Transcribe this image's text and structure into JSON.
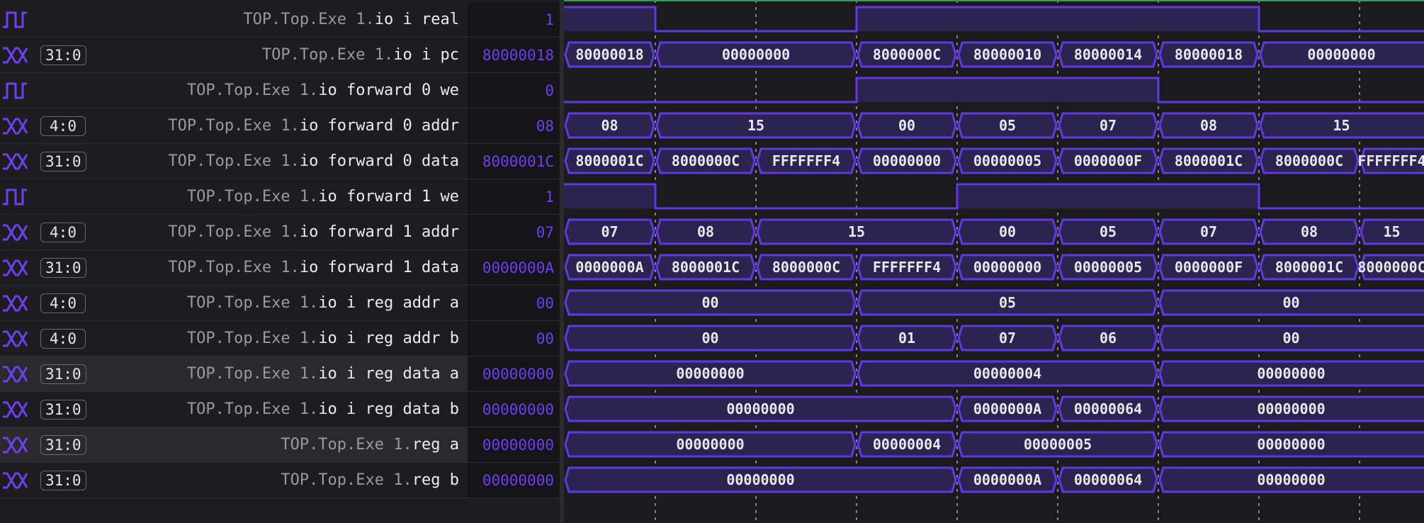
{
  "colors": {
    "accent": "#6d3ff0",
    "wave_stroke": "#6238e6",
    "wave_fill": "#2c2450",
    "background": "#1d1d1f"
  },
  "signals": [
    {
      "type": "bit",
      "width": "",
      "path": "TOP.Top.Exe 1.",
      "tail": "io i real",
      "value": "1"
    },
    {
      "type": "bus",
      "width": "31:0",
      "path": "TOP.Top.Exe 1.",
      "tail": "io i pc",
      "value": "80000018"
    },
    {
      "type": "bit",
      "width": "",
      "path": "TOP.Top.Exe 1.",
      "tail": "io forward 0 we",
      "value": "0"
    },
    {
      "type": "bus",
      "width": "4:0",
      "path": "TOP.Top.Exe 1.",
      "tail": "io forward 0 addr",
      "value": "08"
    },
    {
      "type": "bus",
      "width": "31:0",
      "path": "TOP.Top.Exe 1.",
      "tail": "io forward 0 data",
      "value": "8000001C"
    },
    {
      "type": "bit",
      "width": "",
      "path": "TOP.Top.Exe 1.",
      "tail": "io forward 1 we",
      "value": "1"
    },
    {
      "type": "bus",
      "width": "4:0",
      "path": "TOP.Top.Exe 1.",
      "tail": "io forward 1 addr",
      "value": "07"
    },
    {
      "type": "bus",
      "width": "31:0",
      "path": "TOP.Top.Exe 1.",
      "tail": "io forward 1 data",
      "value": "0000000A"
    },
    {
      "type": "bus",
      "width": "4:0",
      "path": "TOP.Top.Exe 1.",
      "tail": "io i reg addr a",
      "value": "00"
    },
    {
      "type": "bus",
      "width": "4:0",
      "path": "TOP.Top.Exe 1.",
      "tail": "io i reg addr b",
      "value": "00"
    },
    {
      "type": "bus",
      "width": "31:0",
      "path": "TOP.Top.Exe 1.",
      "tail": "io i reg data a",
      "value": "00000000",
      "selected": true
    },
    {
      "type": "bus",
      "width": "31:0",
      "path": "TOP.Top.Exe 1.",
      "tail": "io i reg data b",
      "value": "00000000"
    },
    {
      "type": "bus",
      "width": "31:0",
      "path": "TOP.Top.Exe 1.",
      "tail": "reg a",
      "value": "00000000",
      "selected": true
    },
    {
      "type": "bus",
      "width": "31:0",
      "path": "TOP.Top.Exe 1.",
      "tail": "reg b",
      "value": "00000000"
    }
  ],
  "waveforms": [
    {
      "kind": "bit",
      "segments": [
        {
          "v": 1,
          "s": 0,
          "e": 1
        },
        {
          "v": 0,
          "s": 1,
          "e": 3
        },
        {
          "v": 1,
          "s": 3,
          "e": 7
        },
        {
          "v": 0,
          "s": 7,
          "e": 9
        }
      ]
    },
    {
      "kind": "bus",
      "segments": [
        {
          "label": "80000018",
          "s": 0,
          "e": 1
        },
        {
          "label": "00000000",
          "s": 1,
          "e": 3
        },
        {
          "label": "8000000C",
          "s": 3,
          "e": 4
        },
        {
          "label": "80000010",
          "s": 4,
          "e": 5
        },
        {
          "label": "80000014",
          "s": 5,
          "e": 6
        },
        {
          "label": "80000018",
          "s": 6,
          "e": 7
        },
        {
          "label": "00000000",
          "s": 7,
          "e": 9
        }
      ]
    },
    {
      "kind": "bit",
      "segments": [
        {
          "v": 0,
          "s": 0,
          "e": 3
        },
        {
          "v": 1,
          "s": 3,
          "e": 6
        },
        {
          "v": 0,
          "s": 6,
          "e": 9
        }
      ]
    },
    {
      "kind": "bus",
      "segments": [
        {
          "label": "08",
          "s": 0,
          "e": 1
        },
        {
          "label": "15",
          "s": 1,
          "e": 3
        },
        {
          "label": "00",
          "s": 3,
          "e": 4
        },
        {
          "label": "05",
          "s": 4,
          "e": 5
        },
        {
          "label": "07",
          "s": 5,
          "e": 6
        },
        {
          "label": "08",
          "s": 6,
          "e": 7
        },
        {
          "label": "15",
          "s": 7,
          "e": 9
        }
      ]
    },
    {
      "kind": "bus",
      "segments": [
        {
          "label": "8000001C",
          "s": 0,
          "e": 1
        },
        {
          "label": "8000000C",
          "s": 1,
          "e": 2
        },
        {
          "label": "FFFFFFF4",
          "s": 2,
          "e": 3
        },
        {
          "label": "00000000",
          "s": 3,
          "e": 4
        },
        {
          "label": "00000005",
          "s": 4,
          "e": 5
        },
        {
          "label": "0000000F",
          "s": 5,
          "e": 6
        },
        {
          "label": "8000001C",
          "s": 6,
          "e": 7
        },
        {
          "label": "8000000C",
          "s": 7,
          "e": 8
        },
        {
          "label": "FFFFFFF4",
          "s": 8,
          "e": 9
        }
      ]
    },
    {
      "kind": "bit",
      "segments": [
        {
          "v": 1,
          "s": 0,
          "e": 1
        },
        {
          "v": 0,
          "s": 1,
          "e": 4
        },
        {
          "v": 1,
          "s": 4,
          "e": 7
        },
        {
          "v": 0,
          "s": 7,
          "e": 9
        }
      ]
    },
    {
      "kind": "bus",
      "segments": [
        {
          "label": "07",
          "s": 0,
          "e": 1
        },
        {
          "label": "08",
          "s": 1,
          "e": 2
        },
        {
          "label": "15",
          "s": 2,
          "e": 4
        },
        {
          "label": "00",
          "s": 4,
          "e": 5
        },
        {
          "label": "05",
          "s": 5,
          "e": 6
        },
        {
          "label": "07",
          "s": 6,
          "e": 7
        },
        {
          "label": "08",
          "s": 7,
          "e": 8
        },
        {
          "label": "15",
          "s": 8,
          "e": 9
        }
      ]
    },
    {
      "kind": "bus",
      "segments": [
        {
          "label": "0000000A",
          "s": 0,
          "e": 1
        },
        {
          "label": "8000001C",
          "s": 1,
          "e": 2
        },
        {
          "label": "8000000C",
          "s": 2,
          "e": 3
        },
        {
          "label": "FFFFFFF4",
          "s": 3,
          "e": 4
        },
        {
          "label": "00000000",
          "s": 4,
          "e": 5
        },
        {
          "label": "00000005",
          "s": 5,
          "e": 6
        },
        {
          "label": "0000000F",
          "s": 6,
          "e": 7
        },
        {
          "label": "8000001C",
          "s": 7,
          "e": 8
        },
        {
          "label": "8000000C",
          "s": 8,
          "e": 9
        }
      ]
    },
    {
      "kind": "bus",
      "segments": [
        {
          "label": "00",
          "s": 0,
          "e": 3
        },
        {
          "label": "05",
          "s": 3,
          "e": 6
        },
        {
          "label": "00",
          "s": 6,
          "e": 9
        }
      ]
    },
    {
      "kind": "bus",
      "segments": [
        {
          "label": "00",
          "s": 0,
          "e": 3
        },
        {
          "label": "01",
          "s": 3,
          "e": 4
        },
        {
          "label": "07",
          "s": 4,
          "e": 5
        },
        {
          "label": "06",
          "s": 5,
          "e": 6
        },
        {
          "label": "00",
          "s": 6,
          "e": 9
        }
      ]
    },
    {
      "kind": "bus",
      "segments": [
        {
          "label": "00000000",
          "s": 0,
          "e": 3
        },
        {
          "label": "00000004",
          "s": 3,
          "e": 6
        },
        {
          "label": "00000000",
          "s": 6,
          "e": 9
        }
      ]
    },
    {
      "kind": "bus",
      "segments": [
        {
          "label": "00000000",
          "s": 0,
          "e": 4
        },
        {
          "label": "0000000A",
          "s": 4,
          "e": 5
        },
        {
          "label": "00000064",
          "s": 5,
          "e": 6
        },
        {
          "label": "00000000",
          "s": 6,
          "e": 9
        }
      ]
    },
    {
      "kind": "bus",
      "segments": [
        {
          "label": "00000000",
          "s": 0,
          "e": 3
        },
        {
          "label": "00000004",
          "s": 3,
          "e": 4
        },
        {
          "label": "00000005",
          "s": 4,
          "e": 6
        },
        {
          "label": "00000000",
          "s": 6,
          "e": 9
        }
      ]
    },
    {
      "kind": "bus",
      "segments": [
        {
          "label": "00000000",
          "s": 0,
          "e": 4
        },
        {
          "label": "0000000A",
          "s": 4,
          "e": 5
        },
        {
          "label": "00000064",
          "s": 5,
          "e": 6
        },
        {
          "label": "00000000",
          "s": 6,
          "e": 9
        }
      ]
    }
  ]
}
